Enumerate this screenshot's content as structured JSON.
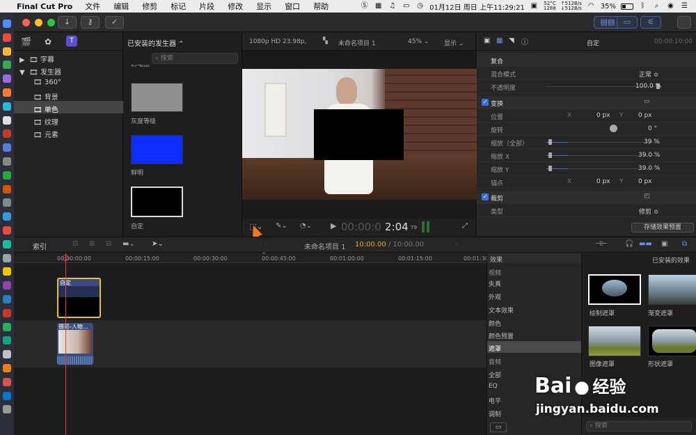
{
  "menubar": {
    "app": "Final Cut Pro",
    "items": [
      "文件",
      "编辑",
      "修剪",
      "标记",
      "片段",
      "修改",
      "显示",
      "窗口",
      "帮助"
    ],
    "tray": {
      "temp": "52°C",
      "mem": "1288",
      "net_up": "↑512B/s",
      "net_down": "↓512B/s",
      "datetime": "01月12日 周日 上午11:29:21",
      "battery": "35%"
    }
  },
  "browser": {
    "tree": [
      {
        "label": "字幕",
        "icon": "▶"
      },
      {
        "label": "发生器",
        "icon": "▼"
      },
      {
        "label": "360°"
      },
      {
        "label": "背景"
      },
      {
        "label": "单色"
      },
      {
        "label": "纹理"
      },
      {
        "label": "元素"
      }
    ],
    "title": "已安装的发生器 ⌃",
    "search_placeholder": "搜索",
    "partial_label": "彩笔圈",
    "items": [
      {
        "label": "灰度等级",
        "color": "#8f8f8f"
      },
      {
        "label": "鲜明",
        "color": "#0d2cff"
      },
      {
        "label": "自定",
        "color": "#000000"
      }
    ]
  },
  "viewer": {
    "format": "1080p HD 23.98p,",
    "project": "未命名项目 1",
    "zoom": "45%",
    "display": "显示",
    "timecode_dim": "00:00:0",
    "timecode": "2:04",
    "frames": "79"
  },
  "inspector": {
    "clip_name": "自定",
    "tc": "00:00:10:00",
    "compositing": {
      "label": "复合",
      "blend_label": "混合模式",
      "blend_value": "正常 ≎",
      "opacity_label": "不透明度",
      "opacity_value": "100.0 %",
      "opacity": 1.0
    },
    "transform": {
      "label": "变换",
      "pos_label": "位置",
      "pos_x_label": "X",
      "pos_x": "0 px",
      "pos_y_label": "Y",
      "pos_y": "0 px",
      "rot_label": "旋转",
      "rot": "0 °",
      "scale_all_label": "缩放（全部）",
      "scale_all": "39 %",
      "scale_x_label": "缩放 X",
      "scale_x": "39.0 %",
      "scale_y_label": "缩放 Y",
      "scale_y": "39.0 %",
      "scale": 0.39,
      "anchor_label": "锚点",
      "anchor_x_label": "X",
      "anchor_x": "0 px",
      "anchor_y_label": "Y",
      "anchor_y": "0 px"
    },
    "crop": {
      "label": "裁剪",
      "type_label": "类型",
      "type_value": "修剪 ≎"
    },
    "save_preset": "存储效果预置"
  },
  "timeline": {
    "index_label": "索引",
    "project": "未命名项目 1",
    "duration": "10:00.00 / 10:00.00",
    "duration_hi": "10:00.00",
    "ruler": [
      "00:00:00:00",
      "00:00:15:00",
      "00:00:30:00",
      "00:00:45:00",
      "00:01:00:00",
      "00:01:15:00",
      "00:01:30:00"
    ],
    "clips": [
      {
        "label": "自定"
      },
      {
        "label": "摄影-人物..."
      }
    ]
  },
  "effects": {
    "title": "效果",
    "installed": "已安装的效果",
    "categories": [
      "视频",
      "失真",
      "外观",
      "文本效果",
      "颜色",
      "颜色预置",
      "遮罩",
      "音频",
      "全部",
      "EQ",
      "电平",
      "调制"
    ],
    "selected": "遮罩",
    "items": [
      {
        "label": "绘制遮罩"
      },
      {
        "label": "渐变遮罩"
      },
      {
        "label": "图像遮罩"
      },
      {
        "label": "形状遮罩"
      }
    ],
    "search_placeholder": "搜索"
  },
  "watermark": {
    "brand": "Bai",
    "brand2": "经验",
    "url": "jingyan.baidu.com"
  },
  "colors": {
    "accent": "#3b5bb5",
    "clip_border": "#e8c23a",
    "playhead": "#e2423a"
  }
}
